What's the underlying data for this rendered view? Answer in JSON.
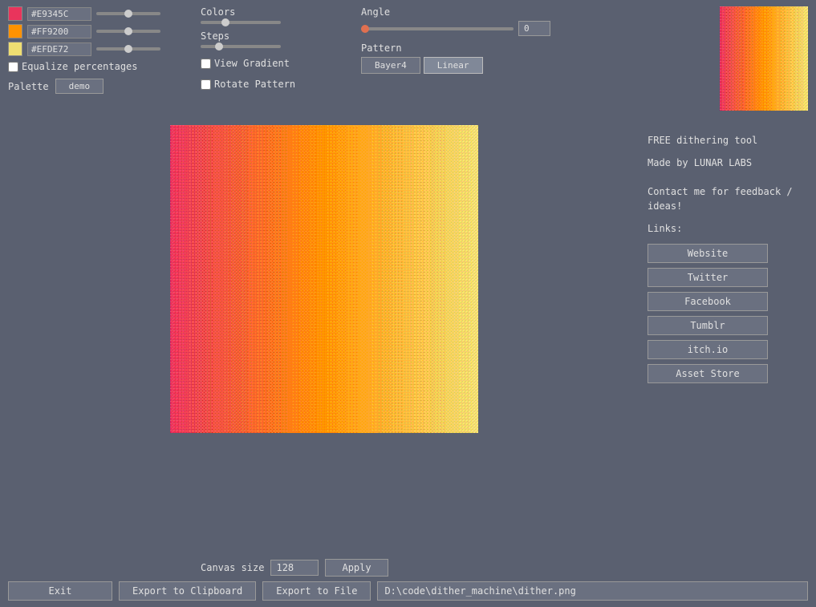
{
  "colors": {
    "swatch1": {
      "hex": "#E9345C",
      "label": "#E9345C",
      "css": "#E9345C"
    },
    "swatch2": {
      "hex": "#FF9200",
      "label": "#FF9200",
      "css": "#FF9200"
    },
    "swatch3": {
      "hex": "#EFDE72",
      "label": "#EFDE72",
      "css": "#EFDE72"
    }
  },
  "equalize": {
    "label": "Equalize percentages"
  },
  "palette": {
    "label": "Palette",
    "value": "demo"
  },
  "controls": {
    "colors_label": "Colors",
    "steps_label": "Steps",
    "view_gradient_label": "View Gradient",
    "rotate_pattern_label": "Rotate Pattern"
  },
  "angle": {
    "label": "Angle",
    "value": "0"
  },
  "pattern": {
    "label": "Pattern",
    "bayer4": "Bayer4",
    "linear": "Linear"
  },
  "info": {
    "line1": "FREE dithering tool",
    "line2": "Made by LUNAR LABS",
    "contact": "Contact me for feedback / ideas!",
    "links_label": "Links:"
  },
  "links": [
    {
      "id": "website",
      "label": "Website"
    },
    {
      "id": "twitter",
      "label": "Twitter"
    },
    {
      "id": "facebook",
      "label": "Facebook"
    },
    {
      "id": "tumblr",
      "label": "Tumblr"
    },
    {
      "id": "itchio",
      "label": "itch.io"
    },
    {
      "id": "assetstore",
      "label": "Asset Store"
    }
  ],
  "canvas_size": {
    "label": "Canvas size",
    "value": "128",
    "apply_label": "Apply"
  },
  "actions": {
    "exit_label": "Exit",
    "export_clipboard": "Export to Clipboard",
    "export_file": "Export to File",
    "filepath": "D:\\code\\dither_machine\\dither.png"
  }
}
